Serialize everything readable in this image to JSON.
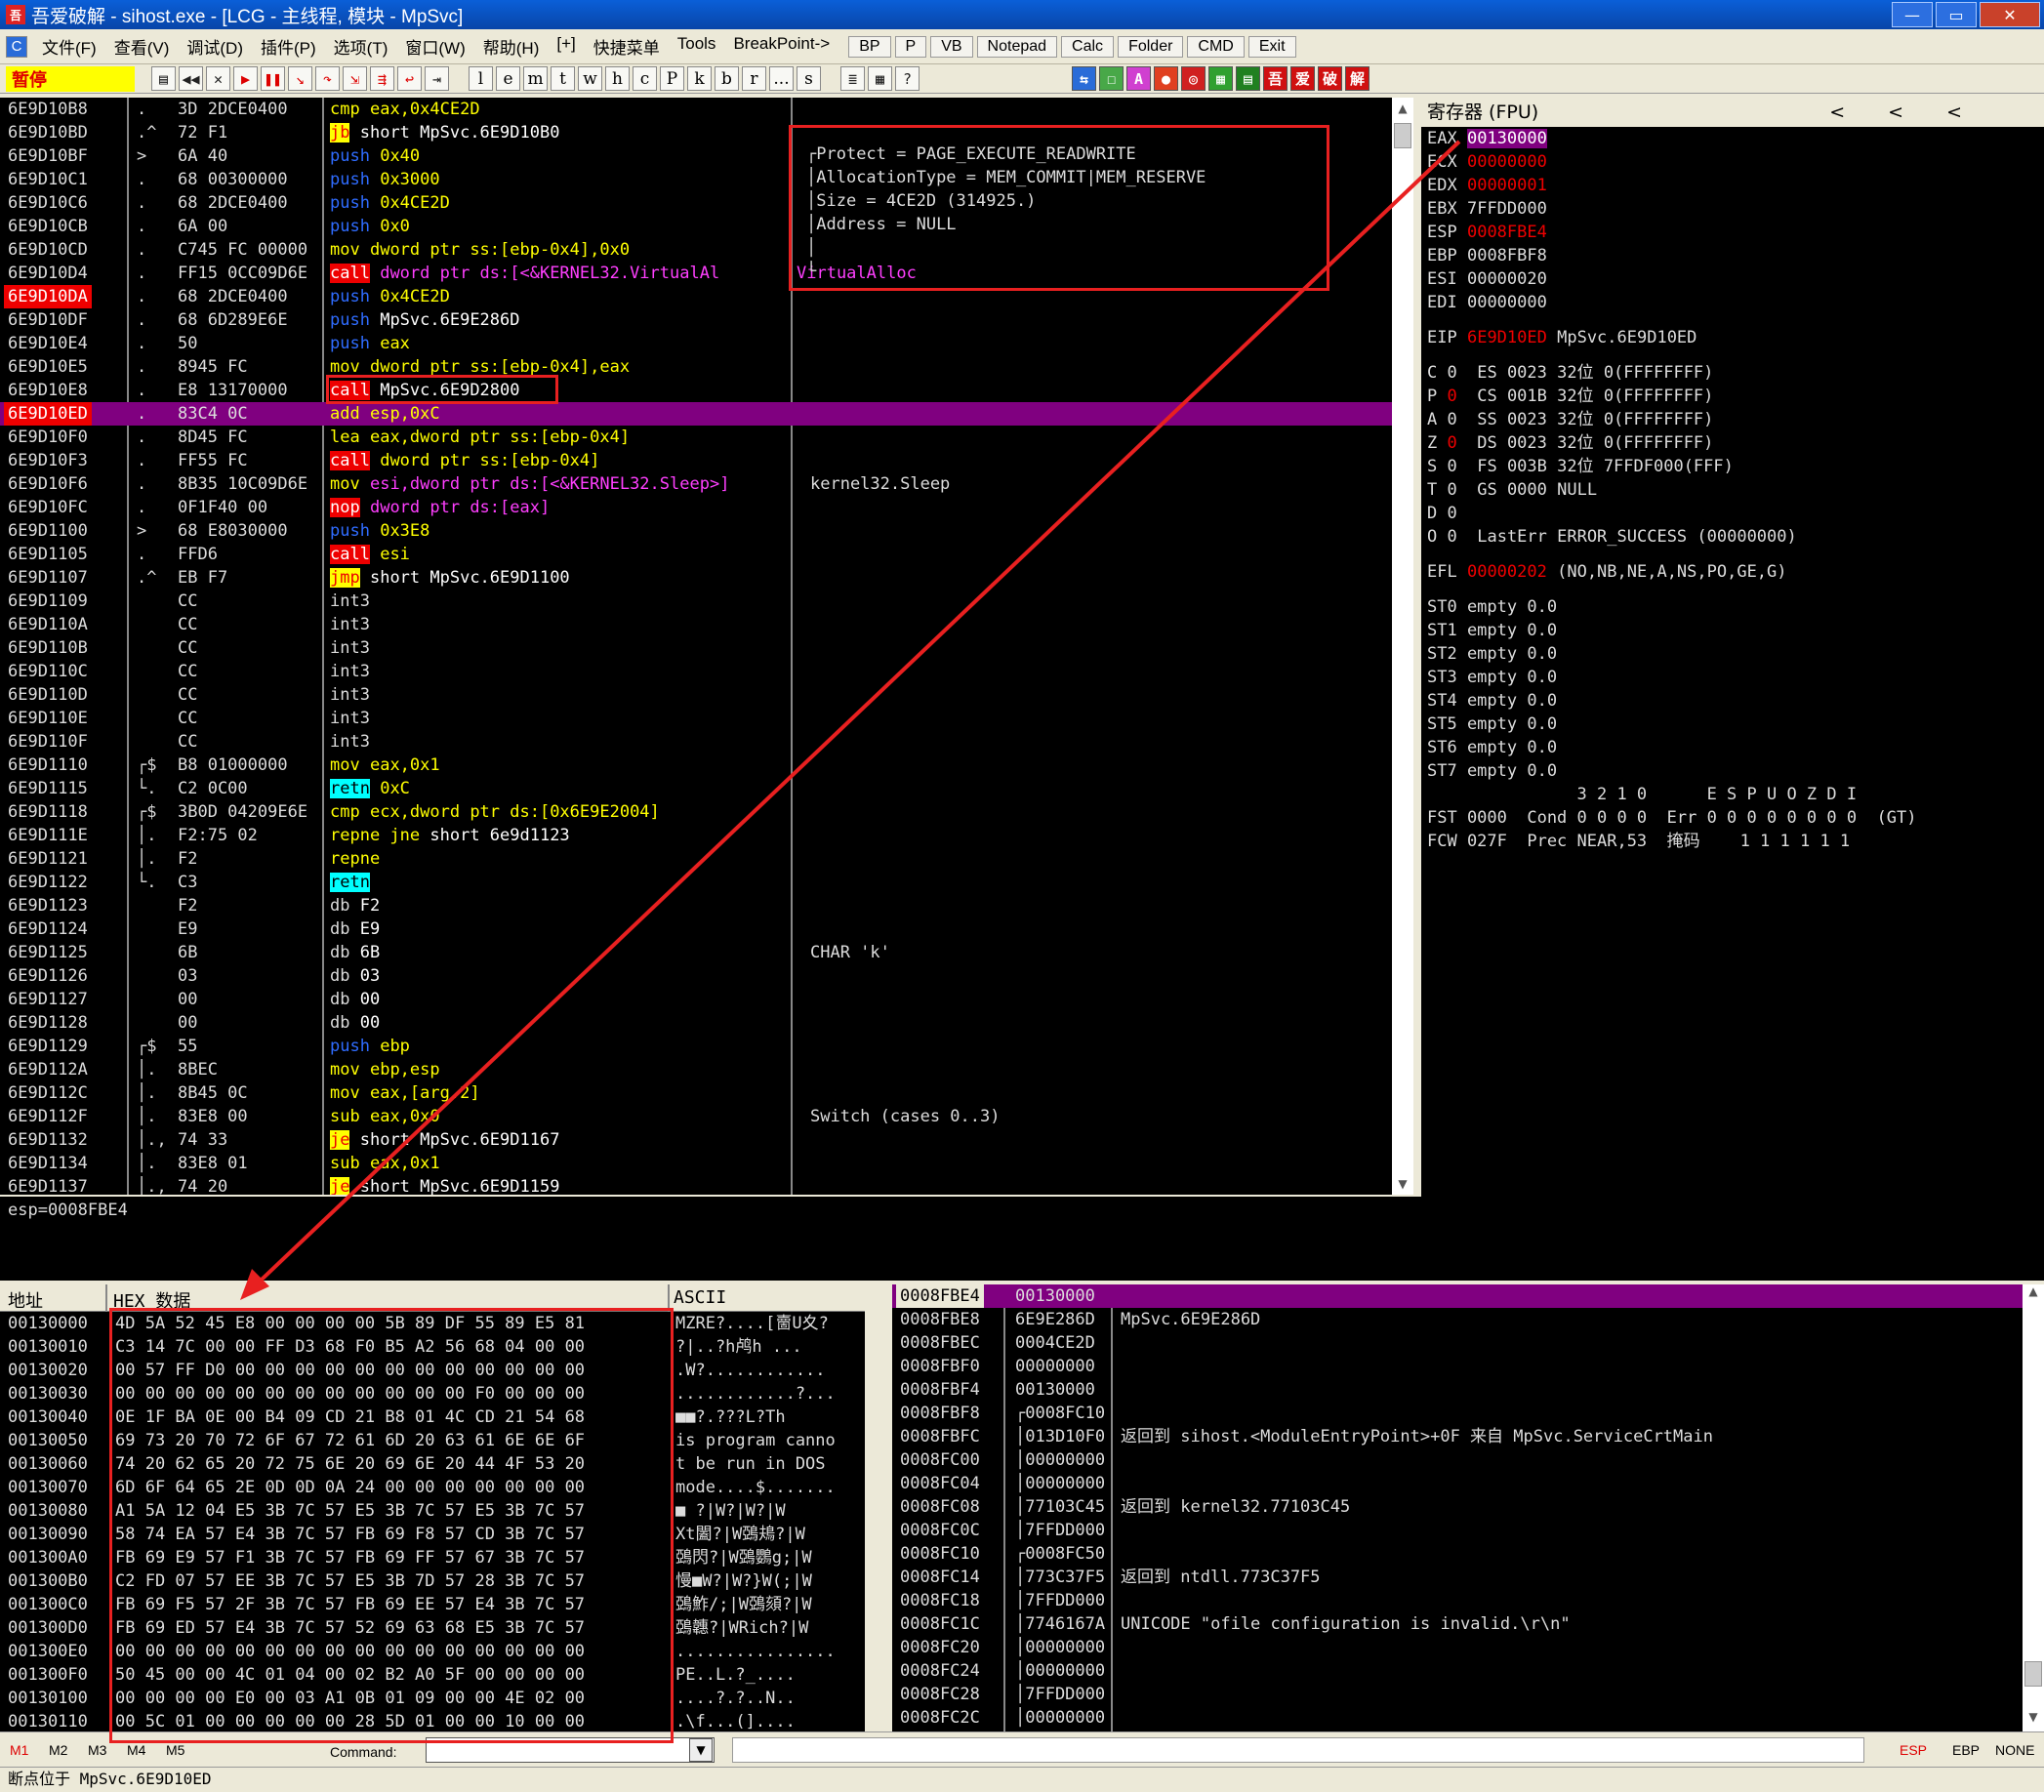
{
  "window": {
    "icon_text": "吾",
    "title": "吾爱破解 - sihost.exe - [LCG - 主线程, 模块 - MpSvc]",
    "min": "—",
    "max": "▭",
    "close": "✕"
  },
  "menu": {
    "items": [
      "文件(F)",
      "查看(V)",
      "调试(D)",
      "插件(P)",
      "选项(T)",
      "窗口(W)",
      "帮助(H)",
      "[+]",
      "快捷菜单",
      "Tools",
      "BreakPoint->"
    ],
    "buttons": [
      "BP",
      "P",
      "VB",
      "Notepad",
      "Calc",
      "Folder",
      "CMD",
      "Exit"
    ],
    "mdi": [
      "—",
      "▭",
      "✕"
    ]
  },
  "toolbar": {
    "status": "暂停",
    "icons": [
      "open-icon",
      "rewind-icon",
      "close-icon",
      "run-icon",
      "pause-icon",
      "step-into-icon",
      "step-over-icon",
      "trace-into-icon",
      "trace-over-icon",
      "execute-till-return-icon",
      "goto-icon"
    ],
    "letters": [
      "l",
      "e",
      "m",
      "t",
      "w",
      "h",
      "c",
      "P",
      "k",
      "b",
      "r",
      "...",
      "s"
    ],
    "extra": [
      "≣",
      "▦",
      "?"
    ],
    "plugin_buttons": [
      {
        "t": "⇆",
        "c": "#2a6cd8"
      },
      {
        "t": "☐",
        "c": "#48a848"
      },
      {
        "t": "A",
        "c": "#d040d0"
      },
      {
        "t": "●",
        "c": "#e04020"
      },
      {
        "t": "◎",
        "c": "#d02020"
      },
      {
        "t": "▦",
        "c": "#30a030"
      },
      {
        "t": "▤",
        "c": "#208020"
      },
      {
        "t": "吾",
        "c": "#d01010"
      },
      {
        "t": "爱",
        "c": "#d01010"
      },
      {
        "t": "破",
        "c": "#d01010"
      },
      {
        "t": "解",
        "c": "#d01010"
      }
    ]
  },
  "disasm": {
    "rows": [
      {
        "addr": "6E9D10B8",
        "j": ".",
        "hex": "3D 2DCE0400",
        "m": "cmp",
        "mc": "m-cmp",
        "o": "eax,0x4CE2D",
        "oc": "op-hex"
      },
      {
        "addr": "6E9D10BD",
        "j": ".^",
        "hex": "72 F1",
        "m": "jb",
        "mc": "m-jcc",
        "o": "short MpSvc.6E9D10B0",
        "oc": "op-lbl"
      },
      {
        "addr": "6E9D10BF",
        "j": ">",
        "hex": "6A 40",
        "m": "push",
        "mc": "m-push",
        "o": "0x40",
        "oc": "op-hex"
      },
      {
        "addr": "6E9D10C1",
        "j": ".",
        "hex": "68 00300000",
        "m": "push",
        "mc": "m-push",
        "o": "0x3000",
        "oc": "op-hex"
      },
      {
        "addr": "6E9D10C6",
        "j": ".",
        "hex": "68 2DCE0400",
        "m": "push",
        "mc": "m-push",
        "o": "0x4CE2D",
        "oc": "op-hex"
      },
      {
        "addr": "6E9D10CB",
        "j": ".",
        "hex": "6A 00",
        "m": "push",
        "mc": "m-push",
        "o": "0x0",
        "oc": "op-hex"
      },
      {
        "addr": "6E9D10CD",
        "j": ".",
        "hex": "C745 FC 00000",
        "m": "mov",
        "mc": "m-mov",
        "o": "dword ptr ss:[ebp-0x4],0x0",
        "oc": "op-mem"
      },
      {
        "addr": "6E9D10D4",
        "j": ".",
        "hex": "FF15 0CC09D6E",
        "m": "call",
        "mc": "m-call",
        "o": "dword ptr ds:[<&KERNEL32.VirtualAl",
        "oc": "op-kern",
        "cmt": "VirtualAlloc"
      },
      {
        "addr": "6E9D10DA",
        "j": ".",
        "hex": "68 2DCE0400",
        "m": "push",
        "mc": "m-push",
        "o": "0x4CE2D",
        "oc": "op-hex",
        "bp": true
      },
      {
        "addr": "6E9D10DF",
        "j": ".",
        "hex": "68 6D289E6E",
        "m": "push",
        "mc": "m-push",
        "o": "MpSvc.6E9E286D",
        "oc": "op-lbl"
      },
      {
        "addr": "6E9D10E4",
        "j": ".",
        "hex": "50",
        "m": "push",
        "mc": "m-push",
        "o": "eax",
        "oc": "op-hex"
      },
      {
        "addr": "6E9D10E5",
        "j": ".",
        "hex": "8945 FC",
        "m": "mov",
        "mc": "m-mov",
        "o": "dword ptr ss:[ebp-0x4],eax",
        "oc": "op-mem"
      },
      {
        "addr": "6E9D10E8",
        "j": ".",
        "hex": "E8 13170000",
        "m": "call",
        "mc": "m-call",
        "o": "MpSvc.6E9D2800",
        "oc": "op-lbl"
      },
      {
        "addr": "6E9D10ED",
        "j": ".",
        "hex": "83C4 0C",
        "m": "add",
        "mc": "m-mov",
        "o": "esp,0xC",
        "oc": "op-hex",
        "cur": true
      },
      {
        "addr": "6E9D10F0",
        "j": ".",
        "hex": "8D45 FC",
        "m": "lea",
        "mc": "m-mov",
        "o": "eax,dword ptr ss:[ebp-0x4]",
        "oc": "op-mem"
      },
      {
        "addr": "6E9D10F3",
        "j": ".",
        "hex": "FF55 FC",
        "m": "call",
        "mc": "m-call",
        "o": "dword ptr ss:[ebp-0x4]",
        "oc": "op-mem"
      },
      {
        "addr": "6E9D10F6",
        "j": ".",
        "hex": "8B35 10C09D6E",
        "m": "mov",
        "mc": "m-mov",
        "o": "esi,dword ptr ds:[<&KERNEL32.Sleep>]",
        "oc": "op-kern",
        "cmt": "kernel32.Sleep"
      },
      {
        "addr": "6E9D10FC",
        "j": ".",
        "hex": "0F1F40 00",
        "m": "nop",
        "mc": "m-nop",
        "o": "dword ptr ds:[eax]",
        "oc": "op-kern"
      },
      {
        "addr": "6E9D1100",
        "j": ">",
        "hex": "68 E8030000",
        "m": "push",
        "mc": "m-push",
        "o": "0x3E8",
        "oc": "op-hex"
      },
      {
        "addr": "6E9D1105",
        "j": ".",
        "hex": "FFD6",
        "m": "call",
        "mc": "m-call",
        "o": "esi",
        "oc": "op-hex"
      },
      {
        "addr": "6E9D1107",
        "j": ".^",
        "hex": "EB F7",
        "m": "jmp",
        "mc": "m-jcc",
        "o": "short MpSvc.6E9D1100",
        "oc": "op-lbl"
      },
      {
        "addr": "6E9D1109",
        "j": "",
        "hex": "CC",
        "m": "int3",
        "mc": "m-def",
        "o": "",
        "oc": "op-lbl"
      },
      {
        "addr": "6E9D110A",
        "j": "",
        "hex": "CC",
        "m": "int3",
        "mc": "m-def",
        "o": "",
        "oc": "op-lbl"
      },
      {
        "addr": "6E9D110B",
        "j": "",
        "hex": "CC",
        "m": "int3",
        "mc": "m-def",
        "o": "",
        "oc": "op-lbl"
      },
      {
        "addr": "6E9D110C",
        "j": "",
        "hex": "CC",
        "m": "int3",
        "mc": "m-def",
        "o": "",
        "oc": "op-lbl"
      },
      {
        "addr": "6E9D110D",
        "j": "",
        "hex": "CC",
        "m": "int3",
        "mc": "m-def",
        "o": "",
        "oc": "op-lbl"
      },
      {
        "addr": "6E9D110E",
        "j": "",
        "hex": "CC",
        "m": "int3",
        "mc": "m-def",
        "o": "",
        "oc": "op-lbl"
      },
      {
        "addr": "6E9D110F",
        "j": "",
        "hex": "CC",
        "m": "int3",
        "mc": "m-def",
        "o": "",
        "oc": "op-lbl"
      },
      {
        "addr": "6E9D1110",
        "j": "┌$",
        "hex": "B8 01000000",
        "m": "mov",
        "mc": "m-mov",
        "o": "eax,0x1",
        "oc": "op-hex"
      },
      {
        "addr": "6E9D1115",
        "j": "└.",
        "hex": "C2 0C00",
        "m": "retn",
        "mc": "m-ret",
        "o": "0xC",
        "oc": "op-hex"
      },
      {
        "addr": "6E9D1118",
        "j": "┌$",
        "hex": "3B0D 04209E6E",
        "m": "cmp",
        "mc": "m-cmp",
        "o": "ecx,dword ptr ds:[0x6E9E2004]",
        "oc": "op-mem"
      },
      {
        "addr": "6E9D111E",
        "j": "│.",
        "hex": "F2:75 02",
        "m": "repne jne",
        "mc": "m-mov",
        "o": "short 6e9d1123",
        "oc": "op-lbl"
      },
      {
        "addr": "6E9D1121",
        "j": "│.",
        "hex": "F2",
        "m": "repne",
        "mc": "m-mov",
        "o": "",
        "oc": "op-lbl"
      },
      {
        "addr": "6E9D1122",
        "j": "└.",
        "hex": "C3",
        "m": "retn",
        "mc": "m-ret",
        "o": "",
        "oc": "op-lbl"
      },
      {
        "addr": "6E9D1123",
        "j": "",
        "hex": "F2",
        "m": "db",
        "mc": "m-def",
        "o": "F2",
        "oc": "op-def"
      },
      {
        "addr": "6E9D1124",
        "j": "",
        "hex": "E9",
        "m": "db",
        "mc": "m-def",
        "o": "E9",
        "oc": "op-def"
      },
      {
        "addr": "6E9D1125",
        "j": "",
        "hex": "6B",
        "m": "db",
        "mc": "m-def",
        "o": "6B",
        "oc": "op-def",
        "cmt": "CHAR 'k'"
      },
      {
        "addr": "6E9D1126",
        "j": "",
        "hex": "03",
        "m": "db",
        "mc": "m-def",
        "o": "03",
        "oc": "op-def"
      },
      {
        "addr": "6E9D1127",
        "j": "",
        "hex": "00",
        "m": "db",
        "mc": "m-def",
        "o": "00",
        "oc": "op-def"
      },
      {
        "addr": "6E9D1128",
        "j": "",
        "hex": "00",
        "m": "db",
        "mc": "m-def",
        "o": "00",
        "oc": "op-def"
      },
      {
        "addr": "6E9D1129",
        "j": "┌$",
        "hex": "55",
        "m": "push",
        "mc": "m-push",
        "o": "ebp",
        "oc": "op-hex"
      },
      {
        "addr": "6E9D112A",
        "j": "│.",
        "hex": "8BEC",
        "m": "mov",
        "mc": "m-mov",
        "o": "ebp,esp",
        "oc": "op-hex"
      },
      {
        "addr": "6E9D112C",
        "j": "│.",
        "hex": "8B45 0C",
        "m": "mov",
        "mc": "m-mov",
        "o": "eax,[arg.2]",
        "oc": "op-hex"
      },
      {
        "addr": "6E9D112F",
        "j": "│.",
        "hex": "83E8 00",
        "m": "sub",
        "mc": "m-mov",
        "o": "eax,0x0",
        "oc": "op-hex",
        "cmt": "Switch (cases 0..3)"
      },
      {
        "addr": "6E9D1132",
        "j": "│.,",
        "hex": "74 33",
        "m": "je",
        "mc": "m-jcc",
        "o": "short MpSvc.6E9D1167",
        "oc": "op-lbl"
      },
      {
        "addr": "6E9D1134",
        "j": "│.",
        "hex": "83E8 01",
        "m": "sub",
        "mc": "m-mov",
        "o": "eax,0x1",
        "oc": "op-hex"
      },
      {
        "addr": "6E9D1137",
        "j": "│.,",
        "hex": "74 20",
        "m": "je",
        "mc": "m-jcc",
        "o": "short MpSvc.6E9D1159",
        "oc": "op-lbl"
      }
    ],
    "params": [
      "Protect = PAGE_EXECUTE_READWRITE",
      "AllocationType = MEM_COMMIT|MEM_RESERVE",
      "Size = 4CE2D (314925.)",
      "Address = NULL"
    ],
    "param_bracket": [
      "┌",
      "│",
      "│",
      "│",
      "│",
      "└"
    ]
  },
  "info": {
    "text": "esp=0008FBE4"
  },
  "registers": {
    "header": "寄存器 (FPU)",
    "arrows": "<<<",
    "general": [
      {
        "n": "EAX",
        "v": "00130000",
        "s": "hl"
      },
      {
        "n": "ECX",
        "v": "00000000",
        "s": "red"
      },
      {
        "n": "EDX",
        "v": "00000001",
        "s": "red"
      },
      {
        "n": "EBX",
        "v": "7FFDD000",
        "s": ""
      },
      {
        "n": "ESP",
        "v": "0008FBE4",
        "s": "red"
      },
      {
        "n": "EBP",
        "v": "0008FBF8",
        "s": ""
      },
      {
        "n": "ESI",
        "v": "00000020",
        "s": ""
      },
      {
        "n": "EDI",
        "v": "00000000",
        "s": ""
      }
    ],
    "eip": {
      "n": "EIP",
      "v": "6E9D10ED",
      "c": "MpSvc.6E9D10ED"
    },
    "flags": [
      {
        "f": "C",
        "v": "0",
        "red": false,
        "seg": "ES 0023 32位 0(FFFFFFFF)"
      },
      {
        "f": "P",
        "v": "0",
        "red": true,
        "seg": "CS 001B 32位 0(FFFFFFFF)"
      },
      {
        "f": "A",
        "v": "0",
        "red": false,
        "seg": "SS 0023 32位 0(FFFFFFFF)"
      },
      {
        "f": "Z",
        "v": "0",
        "red": true,
        "seg": "DS 0023 32位 0(FFFFFFFF)"
      },
      {
        "f": "S",
        "v": "0",
        "red": false,
        "seg": "FS 003B 32位 7FFDF000(FFF)"
      },
      {
        "f": "T",
        "v": "0",
        "red": false,
        "seg": "GS 0000 NULL"
      },
      {
        "f": "D",
        "v": "0",
        "red": false,
        "seg": ""
      },
      {
        "f": "O",
        "v": "0",
        "red": false,
        "seg": "LastErr ERROR_SUCCESS (00000000)"
      }
    ],
    "efl": {
      "n": "EFL",
      "v": "00000202",
      "c": "(NO,NB,NE,A,NS,PO,GE,G)"
    },
    "fpu": [
      "ST0 empty 0.0",
      "ST1 empty 0.0",
      "ST2 empty 0.0",
      "ST3 empty 0.0",
      "ST4 empty 0.0",
      "ST5 empty 0.0",
      "ST6 empty 0.0",
      "ST7 empty 0.0"
    ],
    "fpu_hdr": "               3 2 1 0      E S P U O Z D I",
    "fst": "FST 0000  Cond 0 0 0 0  Err 0 0 0 0 0 0 0 0  (GT)",
    "fcw": "FCW 027F  Prec NEAR,53  掩码    1 1 1 1 1 1"
  },
  "hex": {
    "h_addr": "地址",
    "h_hex": "HEX 数据",
    "h_ascii": "ASCII",
    "rows": [
      {
        "a": "00130000",
        "b": "4D 5A 52 45 E8 00 00 00 00 5B 89 DF 55 89 E5 81",
        "t": "MZRE?....[夁U夊?"
      },
      {
        "a": "00130010",
        "b": "C3 14 7C 00 00 FF D3 68 F0 B5 A2 56 68 04 00 00",
        "t": "?|..?h鸬h ..."
      },
      {
        "a": "00130020",
        "b": "00 57 FF D0 00 00 00 00 00 00 00 00 00 00 00 00",
        "t": ".W?............"
      },
      {
        "a": "00130030",
        "b": "00 00 00 00 00 00 00 00 00 00 00 00 F0 00 00 00",
        "t": "............?..."
      },
      {
        "a": "00130040",
        "b": "0E 1F BA 0E 00 B4 09 CD 21 B8 01 4C CD 21 54 68",
        "t": "■■?.???L?Th"
      },
      {
        "a": "00130050",
        "b": "69 73 20 70 72 6F 67 72 61 6D 20 63 61 6E 6E 6F",
        "t": "is program canno"
      },
      {
        "a": "00130060",
        "b": "74 20 62 65 20 72 75 6E 20 69 6E 20 44 4F 53 20",
        "t": "t be run in DOS "
      },
      {
        "a": "00130070",
        "b": "6D 6F 64 65 2E 0D 0D 0A 24 00 00 00 00 00 00 00",
        "t": "mode....$......."
      },
      {
        "a": "00130080",
        "b": "A1 5A 12 04 E5 3B 7C 57 E5 3B 7C 57 E5 3B 7C 57",
        "t": "■ ?|W?|W?|W"
      },
      {
        "a": "00130090",
        "b": "58 74 EA 57 E4 3B 7C 57 FB 69 F8 57 CD 3B 7C 57",
        "t": "Xt闔?|W鵶鳺?|W"
      },
      {
        "a": "001300A0",
        "b": "FB 69 E9 57 F1 3B 7C 57 FB 69 FF 57 67 3B 7C 57",
        "t": "鵶閃?|W鵶鸚g;|W"
      },
      {
        "a": "001300B0",
        "b": "C2 FD 07 57 EE 3B 7C 57 E5 3B 7D 57 28 3B 7C 57",
        "t": "慢■W?|W?}W(;|W"
      },
      {
        "a": "001300C0",
        "b": "FB 69 F5 57 2F 3B 7C 57 FB 69 EE 57 E4 3B 7C 57",
        "t": "鵶鮓/;|W鵶頦?|W"
      },
      {
        "a": "001300D0",
        "b": "FB 69 ED 57 E4 3B 7C 57 52 69 63 68 E5 3B 7C 57",
        "t": "鵶韢?|WRich?|W"
      },
      {
        "a": "001300E0",
        "b": "00 00 00 00 00 00 00 00 00 00 00 00 00 00 00 00",
        "t": "................"
      },
      {
        "a": "001300F0",
        "b": "50 45 00 00 4C 01 04 00 02 B2 A0 5F 00 00 00 00",
        "t": "PE..L.?_...."
      },
      {
        "a": "00130100",
        "b": "00 00 00 00 E0 00 03 A1 0B 01 09 00 00 4E 02 00",
        "t": "....?.?..N.."
      },
      {
        "a": "00130110",
        "b": "00 5C 01 00 00 00 00 00 28 5D 01 00 00 10 00 00",
        "t": ".\\f...(]...."
      }
    ]
  },
  "stack": {
    "rows": [
      {
        "a": "0008FBE4",
        "v": "00130000",
        "c": "",
        "top": true
      },
      {
        "a": "0008FBE8",
        "v": "6E9E286D",
        "c": "MpSvc.6E9E286D"
      },
      {
        "a": "0008FBEC",
        "v": "0004CE2D",
        "c": ""
      },
      {
        "a": "0008FBF0",
        "v": "00000000",
        "c": ""
      },
      {
        "a": "0008FBF4",
        "v": "00130000",
        "c": ""
      },
      {
        "a": "0008FBF8",
        "v": "┌0008FC10",
        "c": ""
      },
      {
        "a": "0008FBFC",
        "v": "│013D10F0",
        "c": "返回到 sihost.<ModuleEntryPoint>+0F 来自 MpSvc.ServiceCrtMain"
      },
      {
        "a": "0008FC00",
        "v": "│00000000",
        "c": ""
      },
      {
        "a": "0008FC04",
        "v": "│00000000",
        "c": ""
      },
      {
        "a": "0008FC08",
        "v": "│77103C45",
        "c": "返回到 kernel32.77103C45"
      },
      {
        "a": "0008FC0C",
        "v": "│7FFDD000",
        "c": ""
      },
      {
        "a": "0008FC10",
        "v": "┌0008FC50",
        "c": ""
      },
      {
        "a": "0008FC14",
        "v": "│773C37F5",
        "c": "返回到 ntdll.773C37F5"
      },
      {
        "a": "0008FC18",
        "v": "│7FFDD000",
        "c": ""
      },
      {
        "a": "0008FC1C",
        "v": "│7746167A",
        "c": "UNICODE \"ofile configuration is invalid.\\r\\n\""
      },
      {
        "a": "0008FC20",
        "v": "│00000000",
        "c": ""
      },
      {
        "a": "0008FC24",
        "v": "│00000000",
        "c": ""
      },
      {
        "a": "0008FC28",
        "v": "│7FFDD000",
        "c": ""
      },
      {
        "a": "0008FC2C",
        "v": "│00000000",
        "c": ""
      }
    ]
  },
  "cmdbar": {
    "tabs": [
      "M1",
      "M2",
      "M3",
      "M4",
      "M5"
    ],
    "label": "Command:",
    "regs": [
      "ESP",
      "EBP",
      "NONE"
    ]
  },
  "status": {
    "text": "断点位于 MpSvc.6E9D10ED"
  },
  "colors": {
    "annotation": "#e82020",
    "current_line": "#800080",
    "breakpoint": "#e00000"
  }
}
